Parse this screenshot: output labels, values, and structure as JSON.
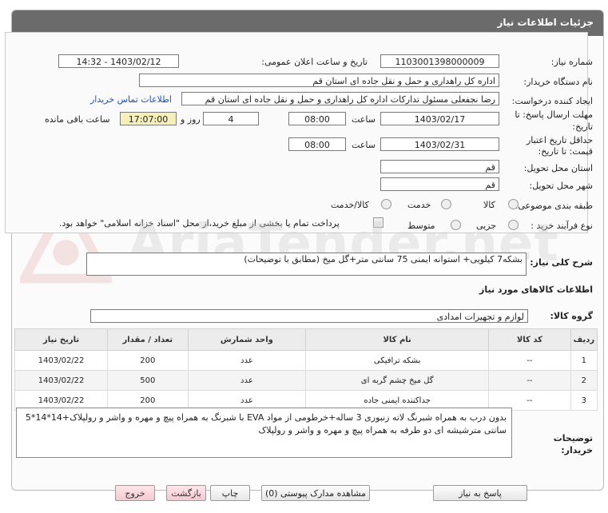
{
  "header": {
    "title": "جزئیات اطلاعات نیاز"
  },
  "fields": {
    "need_number_label": "شماره نیاز:",
    "need_number": "1103001398000009",
    "announce_label": "تاریخ و ساعت اعلان عمومی:",
    "announce_value": "1403/02/12 - 14:32",
    "buyer_org_label": "نام دستگاه خریدار:",
    "buyer_org": "اداره کل راهداری و حمل و نقل جاده ای استان قم",
    "requester_label": "ایجاد کننده درخواست:",
    "requester": "رضا  نجفعلی مسئول تدارکات اداره کل راهداری و حمل و نقل جاده ای استان قم",
    "contact_link": "اطلاعات تماس خریدار",
    "deadline_label_1": "مهلت ارسال پاسخ: تا",
    "deadline_label_2": "تاریخ:",
    "deadline_date": "1403/02/17",
    "time_label": "ساعت",
    "deadline_time": "08:00",
    "days_value": "4",
    "days_label": "روز و",
    "remaining_time": "17:07:00",
    "remaining_label": "ساعت باقی مانده",
    "validity_label_1": "حداقل تاریخ اعتبار",
    "validity_label_2": "قیمت: تا تاریخ:",
    "validity_date": "1403/02/31",
    "validity_time": "08:00",
    "province_label": "استان محل تحویل:",
    "province": "قم",
    "city_label": "شهر محل تحویل:",
    "city": "قم",
    "category_label": "طبقه بندی موضوعی:",
    "category_options": [
      "کالا",
      "خدمت",
      "کالا/خدمت"
    ],
    "purchase_label": "نوع فرآیند خرید :",
    "purchase_options": [
      "جزیی",
      "متوسط"
    ],
    "payment_note": "پرداخت تمام یا بخشی از مبلغ خرید،از محل \"اسناد خزانه اسلامی\" خواهد بود."
  },
  "summary": {
    "label": "شرح کلی نیاز:",
    "value": "بشکه7 کیلویی+ استوانه ایمنی 75 سانتی متر+گل میخ (مطابق با توضیحات)"
  },
  "goods": {
    "section_title": "اطلاعات کالاهای مورد نیاز",
    "group_label": "گروه کالا:",
    "group_value": "لوازم و تجهیزات امدادی",
    "columns": [
      "ردیف",
      "کد کالا",
      "نام کالا",
      "واحد شمارش",
      "تعداد / مقدار",
      "تاریخ نیاز"
    ],
    "rows": [
      {
        "idx": "1",
        "code": "--",
        "name": "بشکه ترافیکی",
        "unit": "عدد",
        "qty": "200",
        "date": "1403/02/22"
      },
      {
        "idx": "2",
        "code": "--",
        "name": "گل میخ چشم گربه ای",
        "unit": "عدد",
        "qty": "500",
        "date": "1403/02/22"
      },
      {
        "idx": "3",
        "code": "--",
        "name": "جداکننده ایمنی جاده",
        "unit": "عدد",
        "qty": "200",
        "date": "1403/02/22"
      }
    ]
  },
  "buyer_notes": {
    "label_1": "توضیحات",
    "label_2": "خریدار:",
    "text": "بدون درب به همراه شبرنگ لاته زنبوری 3 ساله+خرطومی از مواد EVA با شبرنگ به همراه پیچ و مهره و واشر و رولپلاک+14*14*5 سانتی مترشیشه ای دو طرفه به همراه پیچ و مهره و واشر و رولپلاک"
  },
  "buttons": {
    "reply": "پاسخ به نیاز",
    "attachments": "مشاهده مدارک پیوستی (0)",
    "print": "چاپ",
    "back": "بازگشت",
    "exit": "خروج"
  }
}
